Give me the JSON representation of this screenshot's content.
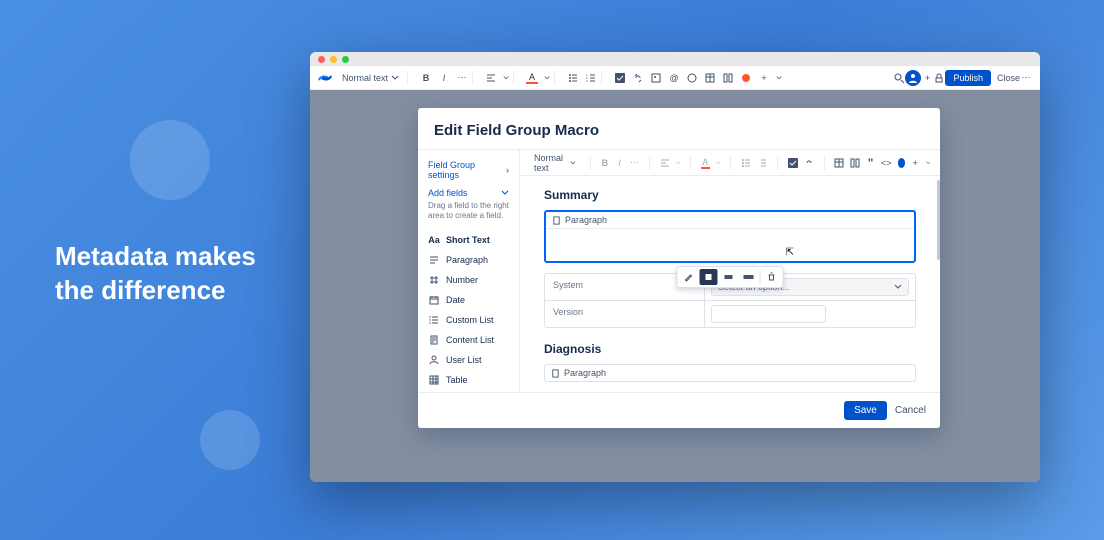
{
  "hero_line1": "Metadata makes",
  "hero_line2": "the difference",
  "toolbar": {
    "text_style": "Normal text",
    "publish": "Publish",
    "close": "Close"
  },
  "modal": {
    "title": "Edit Field Group Macro",
    "side": {
      "settings": "Field Group settings",
      "add_fields": "Add fields",
      "hint": "Drag a field to the right area to create a field.",
      "fields": [
        {
          "label": "Short Text",
          "icon": "Aa",
          "bold": true
        },
        {
          "label": "Paragraph",
          "icon": "para"
        },
        {
          "label": "Number",
          "icon": "hash"
        },
        {
          "label": "Date",
          "icon": "cal"
        },
        {
          "label": "Custom List",
          "icon": "list"
        },
        {
          "label": "Content List",
          "icon": "doc"
        },
        {
          "label": "User List",
          "icon": "user"
        },
        {
          "label": "Table",
          "icon": "table"
        }
      ]
    },
    "editor": {
      "text_style": "Normal text",
      "summary": "Summary",
      "para_label": "Paragraph",
      "system": "System",
      "system_ph": "Select an option...",
      "version": "Version",
      "diagnosis": "Diagnosis",
      "para2_label": "Paragraph"
    },
    "footer": {
      "save": "Save",
      "cancel": "Cancel"
    }
  }
}
